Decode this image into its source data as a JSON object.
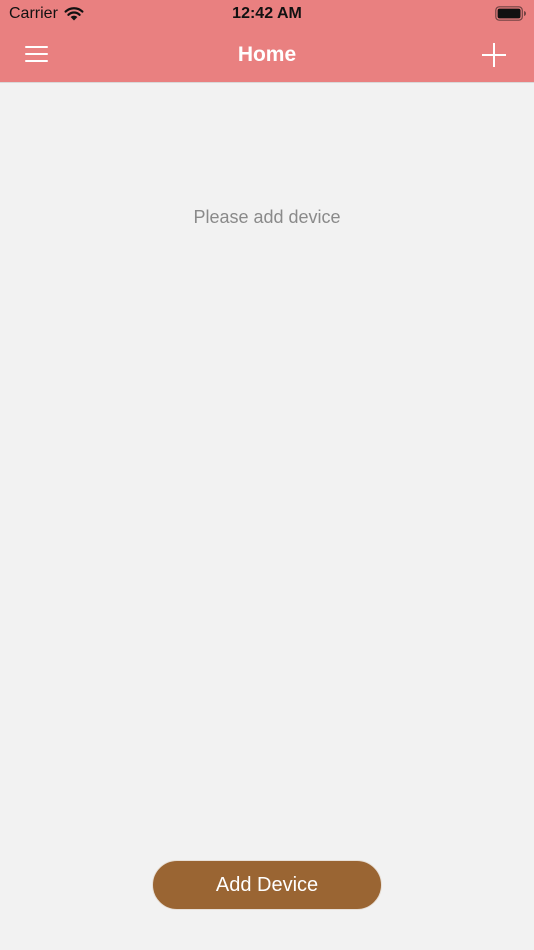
{
  "status_bar": {
    "carrier": "Carrier",
    "time": "12:42 AM",
    "wifi_icon": "wifi-icon",
    "battery_icon": "battery-icon"
  },
  "nav_bar": {
    "title": "Home",
    "menu_icon": "hamburger-menu-icon",
    "add_icon": "plus-icon"
  },
  "main": {
    "empty_message": "Please add device",
    "add_device_label": "Add Device"
  },
  "colors": {
    "header_background": "#e98080",
    "page_background": "#f2f2f2",
    "button_background": "#9a6533",
    "message_text": "#8a8a8a"
  }
}
